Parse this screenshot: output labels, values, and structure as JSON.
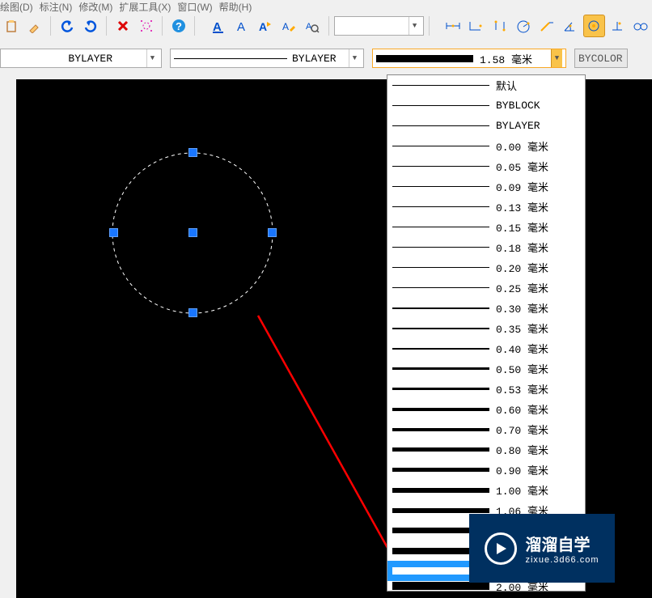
{
  "menu": {
    "items": [
      "绘图(D)",
      "标注(N)",
      "修改(M)",
      "扩展工具(X)",
      "窗口(W)",
      "帮助(H)"
    ]
  },
  "props": {
    "layer": "BYLAYER",
    "linetype": "BYLAYER",
    "lineweight_label": "1.58 毫米",
    "color": "BYCOLOR"
  },
  "lw_options": [
    {
      "label": "默认",
      "w": 1
    },
    {
      "label": "BYBLOCK",
      "w": 1
    },
    {
      "label": "BYLAYER",
      "w": 1
    },
    {
      "label": "0.00 毫米",
      "w": 1
    },
    {
      "label": "0.05 毫米",
      "w": 1
    },
    {
      "label": "0.09 毫米",
      "w": 1
    },
    {
      "label": "0.13 毫米",
      "w": 1
    },
    {
      "label": "0.15 毫米",
      "w": 1
    },
    {
      "label": "0.18 毫米",
      "w": 1
    },
    {
      "label": "0.20 毫米",
      "w": 1
    },
    {
      "label": "0.25 毫米",
      "w": 1
    },
    {
      "label": "0.30 毫米",
      "w": 2
    },
    {
      "label": "0.35 毫米",
      "w": 2
    },
    {
      "label": "0.40 毫米",
      "w": 2
    },
    {
      "label": "0.50 毫米",
      "w": 3
    },
    {
      "label": "0.53 毫米",
      "w": 3
    },
    {
      "label": "0.60 毫米",
      "w": 4
    },
    {
      "label": "0.70 毫米",
      "w": 4
    },
    {
      "label": "0.80 毫米",
      "w": 5
    },
    {
      "label": "0.90 毫米",
      "w": 5
    },
    {
      "label": "1.00 毫米",
      "w": 6
    },
    {
      "label": "1.06 毫米",
      "w": 6
    },
    {
      "label": "",
      "w": 7
    },
    {
      "label": "",
      "w": 8
    },
    {
      "label": "",
      "w": 9,
      "selected": true
    }
  ],
  "lw_extra": {
    "label": "2.00 毫米",
    "w": 10
  },
  "watermark": {
    "title": "溜溜自学",
    "url": "zixue.3d66.com"
  }
}
